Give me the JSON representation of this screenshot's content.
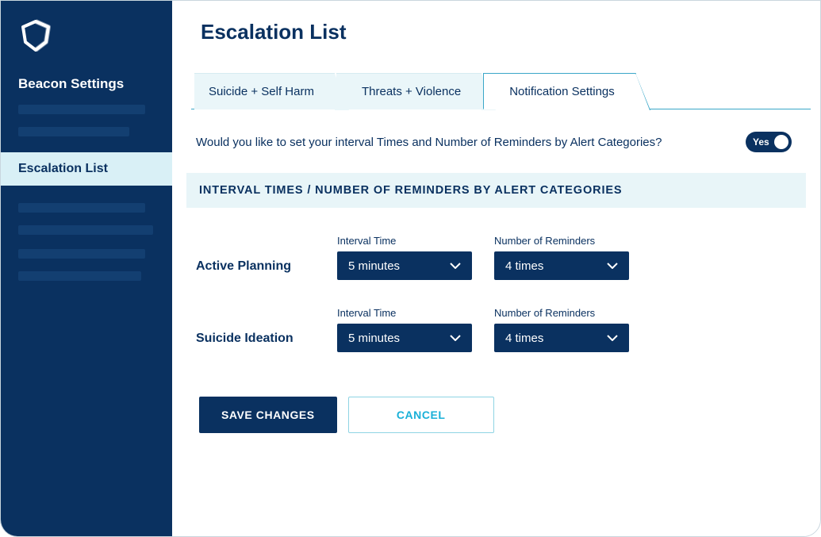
{
  "sidebar": {
    "heading": "Beacon Settings",
    "active_item": "Escalation List"
  },
  "page": {
    "title": "Escalation List"
  },
  "tabs": [
    {
      "label": "Suicide + Self Harm",
      "active": false
    },
    {
      "label": "Threats + Violence",
      "active": false
    },
    {
      "label": "Notification Settings",
      "active": true
    }
  ],
  "question": {
    "text": "Would you like to set your interval Times and Number of Reminders by Alert Categories?",
    "toggle_label": "Yes",
    "toggle_on": true
  },
  "section_banner": "INTERVAL TIMES / NUMBER OF REMINDERS BY ALERT CATEGORIES",
  "field_labels": {
    "interval": "Interval Time",
    "reminders": "Number of Reminders"
  },
  "categories": [
    {
      "name": "Active Planning",
      "interval": "5 minutes",
      "reminders": "4 times"
    },
    {
      "name": "Suicide Ideation",
      "interval": "5 minutes",
      "reminders": "4 times"
    }
  ],
  "actions": {
    "save": "SAVE CHANGES",
    "cancel": "CANCEL"
  },
  "colors": {
    "brand_dark": "#0a3160",
    "accent": "#19b0d8",
    "pale": "#e8f5f8"
  }
}
